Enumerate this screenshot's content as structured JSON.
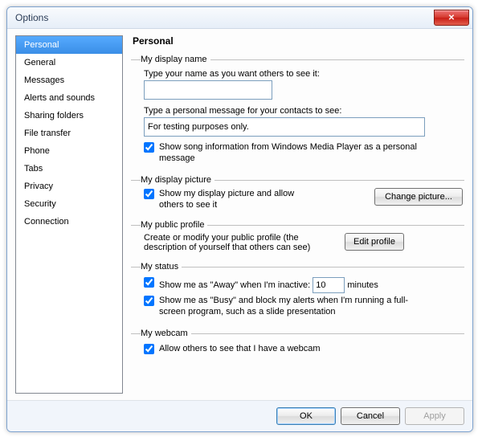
{
  "window": {
    "title": "Options"
  },
  "sidebar": {
    "items": [
      {
        "label": "Personal",
        "selected": true
      },
      {
        "label": "General"
      },
      {
        "label": "Messages"
      },
      {
        "label": "Alerts and sounds"
      },
      {
        "label": "Sharing folders"
      },
      {
        "label": "File transfer"
      },
      {
        "label": "Phone"
      },
      {
        "label": "Tabs"
      },
      {
        "label": "Privacy"
      },
      {
        "label": "Security"
      },
      {
        "label": "Connection"
      }
    ]
  },
  "page": {
    "heading": "Personal",
    "display_name": {
      "legend": "My display name",
      "prompt": "Type your name as you want others to see it:",
      "value": "",
      "msg_prompt": "Type a personal message for your contacts to see:",
      "msg_value": "For testing purposes only.",
      "song_label": "Show song information from Windows Media Player as a personal message",
      "song_checked": true
    },
    "display_picture": {
      "legend": "My display picture",
      "show_label": "Show my display picture and allow others to see it",
      "show_checked": true,
      "change_btn": "Change picture..."
    },
    "public_profile": {
      "legend": "My public profile",
      "desc": "Create or modify your public profile (the description of yourself that others can see)",
      "edit_btn": "Edit profile"
    },
    "status": {
      "legend": "My status",
      "away_prefix": "Show me as \"Away\" when I'm inactive:",
      "away_minutes": "10",
      "away_suffix": "minutes",
      "away_checked": true,
      "busy_label": "Show me as \"Busy\" and block my alerts when I'm running a full-screen program, such as a slide presentation",
      "busy_checked": true
    },
    "webcam": {
      "legend": "My webcam",
      "allow_label": "Allow others to see that I have a webcam",
      "allow_checked": true
    }
  },
  "footer": {
    "ok": "OK",
    "cancel": "Cancel",
    "apply": "Apply"
  }
}
